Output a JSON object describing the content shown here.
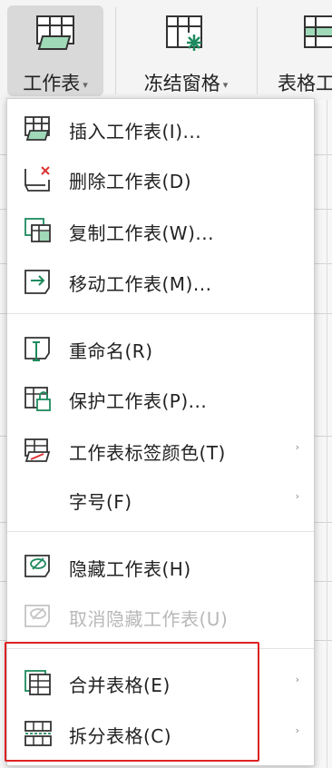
{
  "ribbon": {
    "worksheet_label": "工作表",
    "freeze_label": "冻结窗格",
    "table_tools_label": "表格工"
  },
  "menu": {
    "items": [
      {
        "label": "插入工作表(I)...",
        "icon": "insert-sheet-icon"
      },
      {
        "label": "删除工作表(D)",
        "icon": "delete-sheet-icon"
      },
      {
        "label": "复制工作表(W)...",
        "icon": "copy-sheet-icon"
      },
      {
        "label": "移动工作表(M)...",
        "icon": "move-sheet-icon"
      },
      {
        "label": "重命名(R)",
        "icon": "rename-icon"
      },
      {
        "label": "保护工作表(P)...",
        "icon": "protect-sheet-icon"
      },
      {
        "label": "工作表标签颜色(T)",
        "icon": "tab-color-icon"
      },
      {
        "label": "字号(F)",
        "icon": ""
      },
      {
        "label": "隐藏工作表(H)",
        "icon": "hide-sheet-icon"
      },
      {
        "label": "取消隐藏工作表(U)",
        "icon": "unhide-sheet-icon"
      },
      {
        "label": "合并表格(E)",
        "icon": "merge-tables-icon"
      },
      {
        "label": "拆分表格(C)",
        "icon": "split-table-icon"
      }
    ]
  },
  "colors": {
    "accent": "#1e8a5e",
    "highlight_box": "#dd2222",
    "disabled_text": "#b8b8b8"
  }
}
